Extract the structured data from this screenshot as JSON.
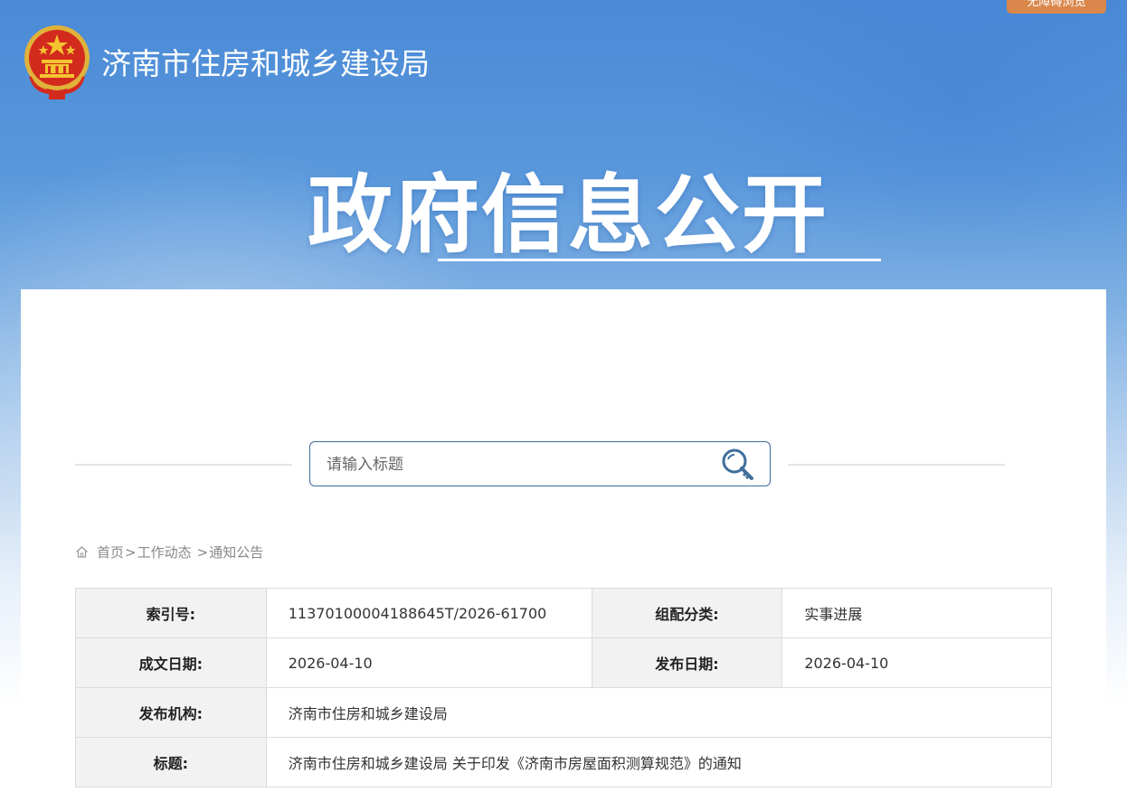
{
  "accessibility_label": "无障碍浏览",
  "site_name": "济南市住房和城乡建设局",
  "hero_title": "政府信息公开",
  "search": {
    "placeholder": "请输入标题"
  },
  "breadcrumb": {
    "items": [
      "首页",
      "工作动态",
      "通知公告"
    ],
    "separator": ">"
  },
  "info_table": {
    "index_label": "索引号:",
    "index_value": "11370100004188645T/2026-61700",
    "category_label": "组配分类:",
    "category_value": "实事进展",
    "written_date_label": "成文日期:",
    "written_date_value": "2026-04-10",
    "publish_date_label": "发布日期:",
    "publish_date_value": "2026-04-10",
    "publisher_label": "发布机构:",
    "publisher_value": "济南市住房和城乡建设局",
    "title_label": "标题:",
    "title_value": "济南市住房和城乡建设局 关于印发《济南市房屋面积测算规范》的通知"
  },
  "colors": {
    "banner_blue": "#4a8ad6",
    "accessibility_orange": "#d9874a",
    "search_border": "#3d6a99",
    "label_bg": "#f2f2f2"
  },
  "icons": {
    "emblem": "national-emblem-icon",
    "search": "search-key-icon",
    "home": "home-icon"
  }
}
